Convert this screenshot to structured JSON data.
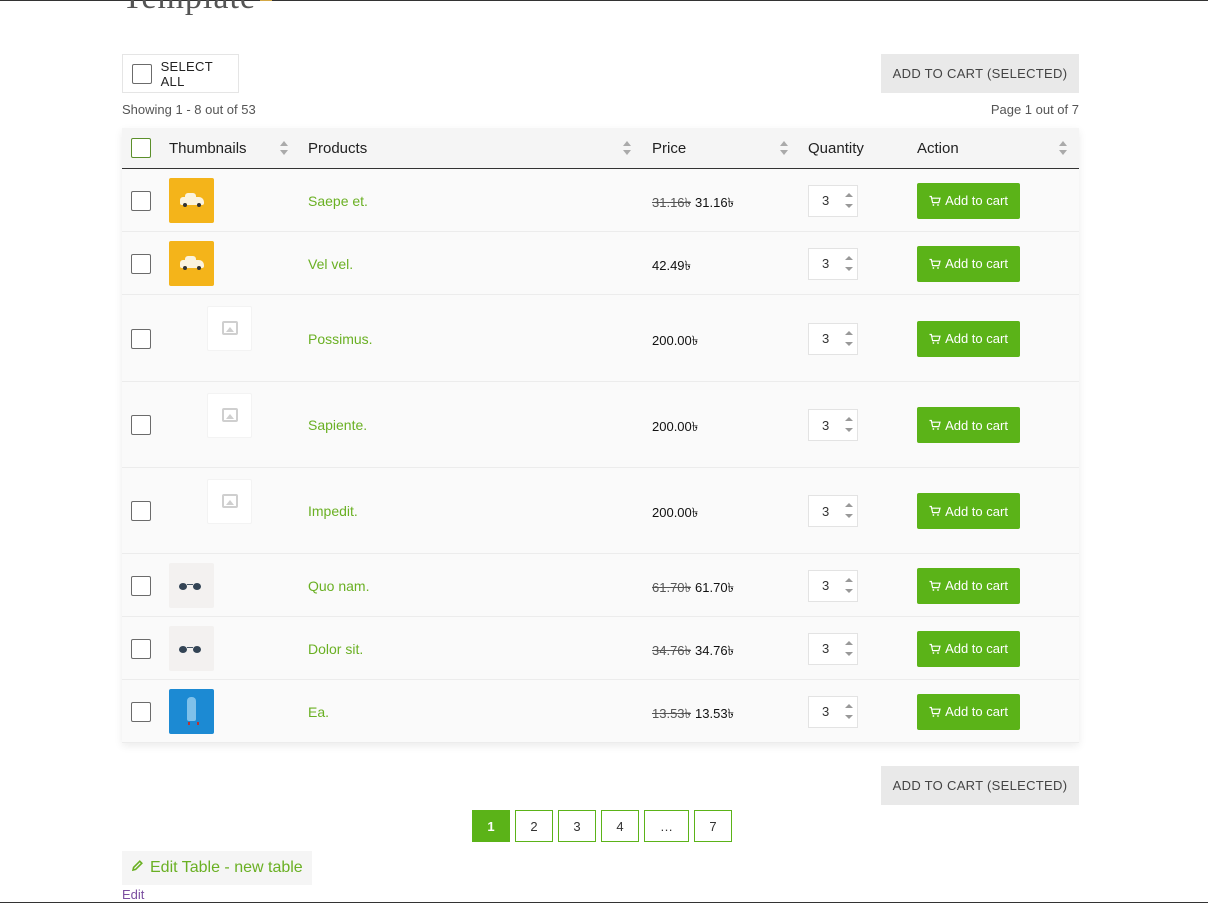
{
  "page": {
    "title": "Template"
  },
  "toolbar": {
    "select_all_label": "SELECT ALL",
    "add_selected_label": "ADD TO CART (SELECTED)",
    "showing_text": "Showing 1 - 8 out of 53",
    "page_text": "Page 1 out of 7"
  },
  "table": {
    "headers": {
      "thumbnails": "Thumbnails",
      "products": "Products",
      "price": "Price",
      "quantity": "Quantity",
      "action": "Action"
    },
    "add_to_cart_label": "Add to cart",
    "rows": [
      {
        "name": "Saepe et.",
        "old_price": "31.16৳",
        "price": "31.16৳",
        "qty": "3",
        "thumb": "yellow-car"
      },
      {
        "name": "Vel vel.",
        "old_price": "",
        "price": "42.49৳",
        "qty": "3",
        "thumb": "yellow-car"
      },
      {
        "name": "Possimus.",
        "old_price": "",
        "price": "200.00৳",
        "qty": "3",
        "thumb": "placeholder-image"
      },
      {
        "name": "Sapiente.",
        "old_price": "",
        "price": "200.00৳",
        "qty": "3",
        "thumb": "placeholder-image"
      },
      {
        "name": "Impedit.",
        "old_price": "",
        "price": "200.00৳",
        "qty": "3",
        "thumb": "placeholder-image"
      },
      {
        "name": "Quo nam.",
        "old_price": "61.70৳",
        "price": "61.70৳",
        "qty": "3",
        "thumb": "sunglasses"
      },
      {
        "name": "Dolor sit.",
        "old_price": "34.76৳",
        "price": "34.76৳",
        "qty": "3",
        "thumb": "sunglasses"
      },
      {
        "name": "Ea.",
        "old_price": "13.53৳",
        "price": "13.53৳",
        "qty": "3",
        "thumb": "blue-figure"
      }
    ]
  },
  "pagination": {
    "pages": [
      "1",
      "2",
      "3",
      "4",
      "…",
      "7"
    ],
    "current": "1"
  },
  "footer": {
    "edit_table_label": "Edit Table - new table",
    "edit_link": "Edit"
  },
  "colors": {
    "accent": "#5bb318",
    "link": "#6ab023",
    "edit_link": "#7b4fa0"
  }
}
